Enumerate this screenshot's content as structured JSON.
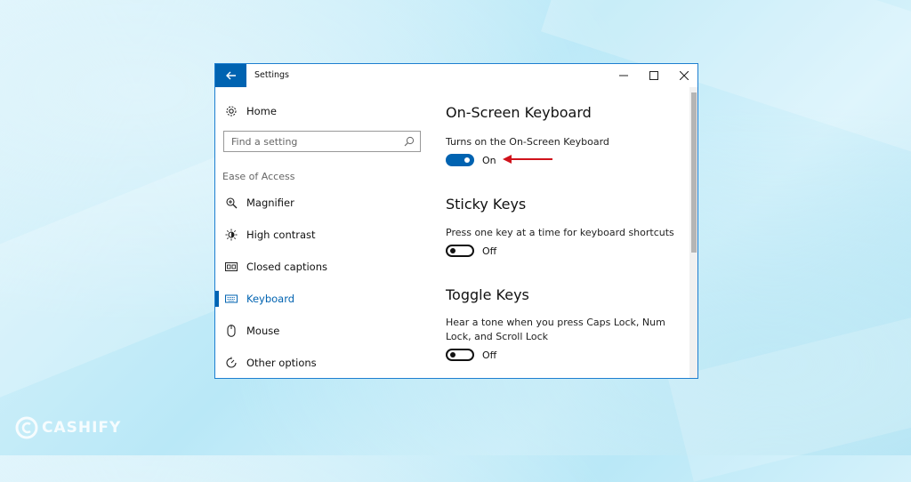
{
  "window": {
    "title": "Settings"
  },
  "sidebar": {
    "home_label": "Home",
    "search": {
      "placeholder": "Find a setting"
    },
    "section_heading": "Ease of Access",
    "items": [
      {
        "label": "Magnifier",
        "icon": "magnifier-icon"
      },
      {
        "label": "High contrast",
        "icon": "contrast-icon"
      },
      {
        "label": "Closed captions",
        "icon": "captions-icon"
      },
      {
        "label": "Keyboard",
        "icon": "keyboard-icon",
        "selected": true
      },
      {
        "label": "Mouse",
        "icon": "mouse-icon"
      },
      {
        "label": "Other options",
        "icon": "other-options-icon"
      }
    ]
  },
  "content": {
    "sections": [
      {
        "title": "On-Screen Keyboard",
        "description": "Turns on the On-Screen Keyboard",
        "toggle_state": "On",
        "on": true
      },
      {
        "title": "Sticky Keys",
        "description": "Press one key at a time for keyboard shortcuts",
        "toggle_state": "Off",
        "on": false
      },
      {
        "title": "Toggle Keys",
        "description": "Hear a tone when you press Caps Lock, Num Lock, and Scroll Lock",
        "toggle_state": "Off",
        "on": false
      }
    ]
  },
  "watermark": {
    "brand": "CASHIFY"
  },
  "colors": {
    "accent": "#0063b1",
    "arrow": "#d0121b",
    "window_border": "#1e7fd0"
  }
}
